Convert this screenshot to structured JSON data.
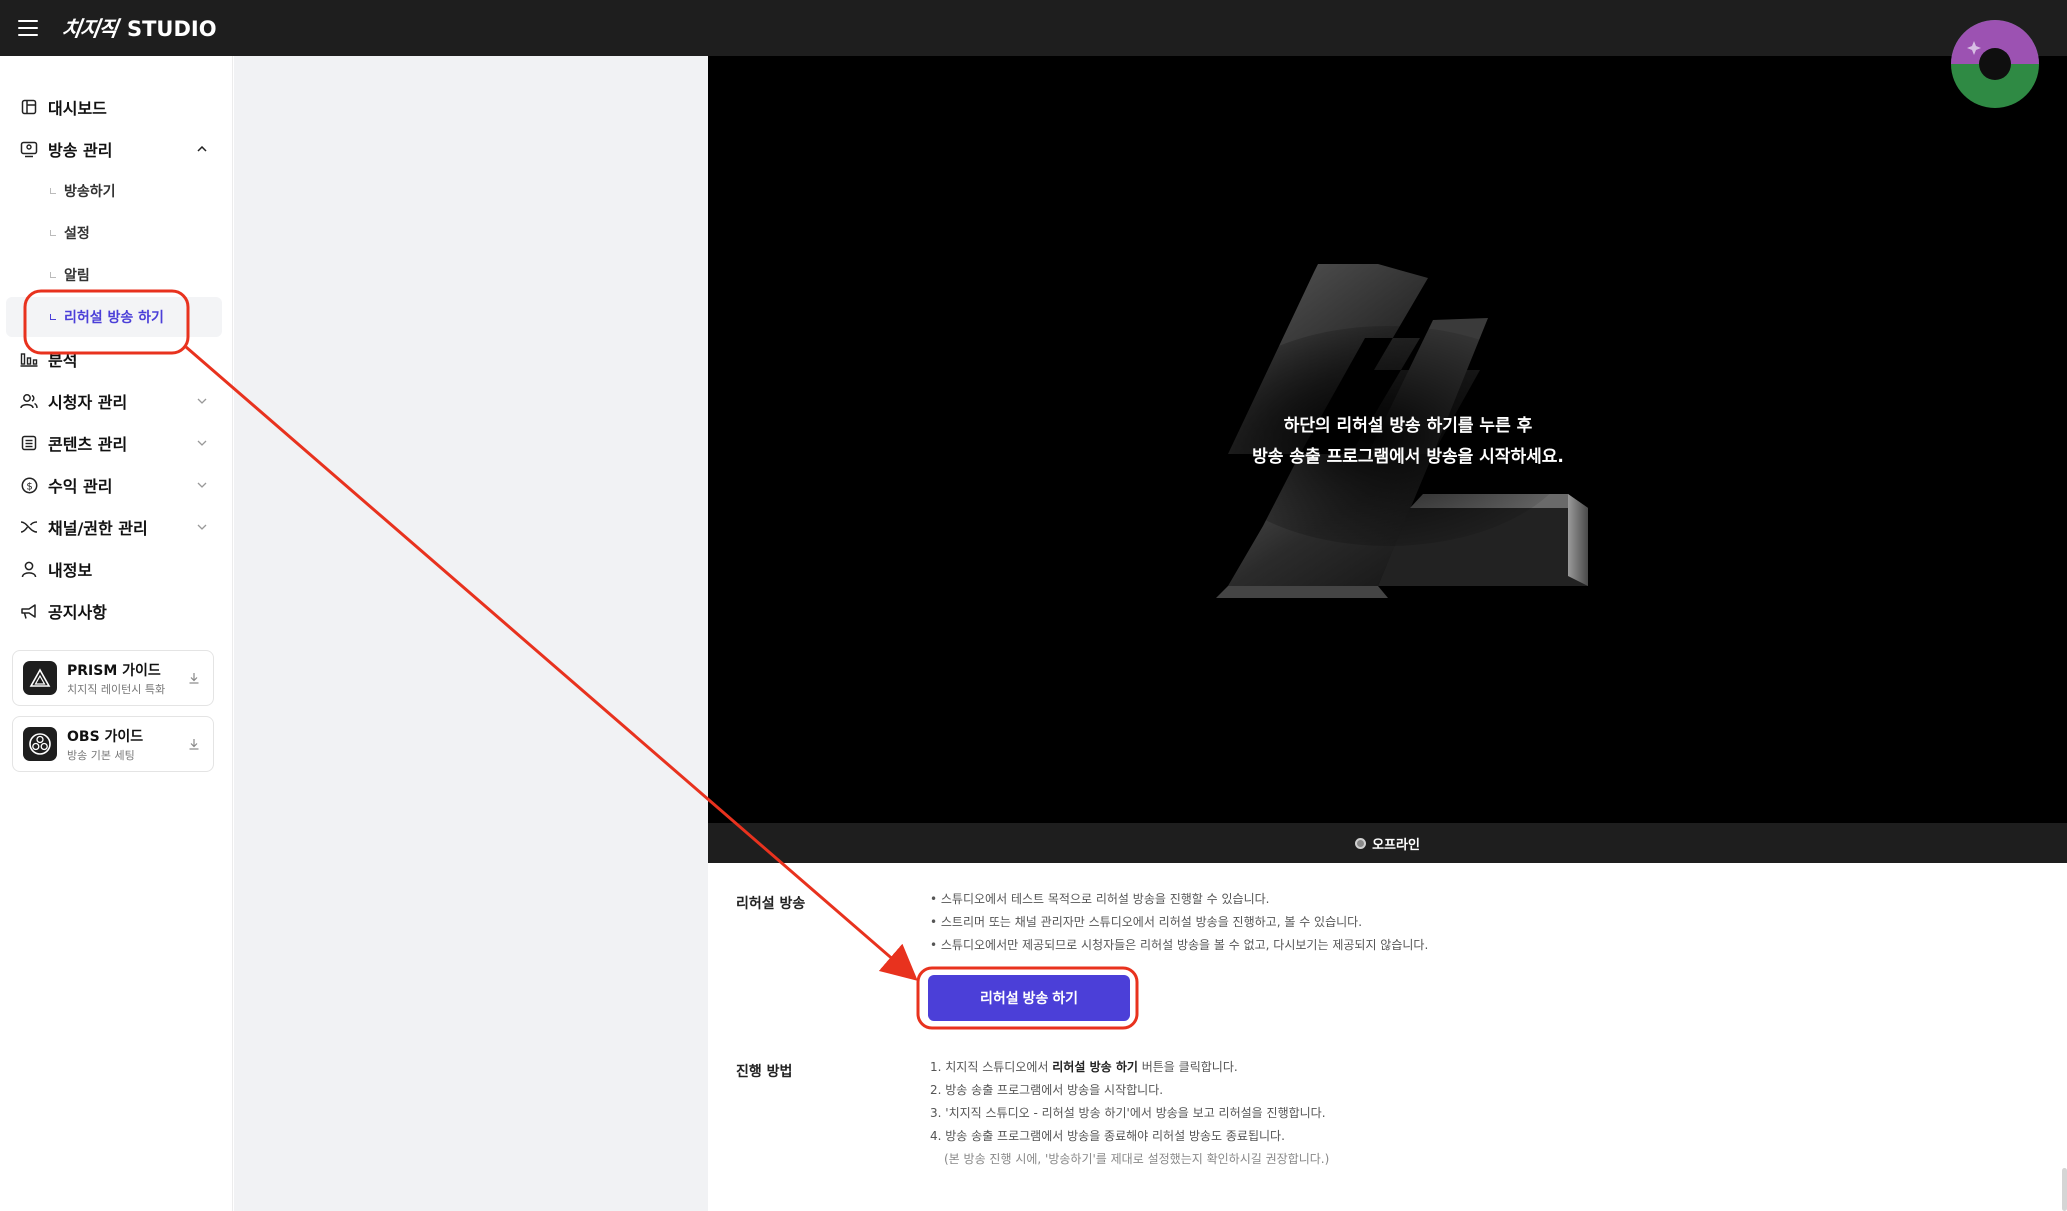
{
  "header": {
    "logo_text": "치지직",
    "studio_text": "STUDIO"
  },
  "sidebar": {
    "items": [
      {
        "label": "대시보드",
        "icon": "dashboard-icon"
      },
      {
        "label": "방송 관리",
        "icon": "broadcast-icon",
        "expanded": true
      },
      {
        "label": "분석",
        "icon": "analytics-icon"
      },
      {
        "label": "시청자 관리",
        "icon": "viewers-icon"
      },
      {
        "label": "콘텐츠 관리",
        "icon": "content-icon"
      },
      {
        "label": "수익 관리",
        "icon": "revenue-icon"
      },
      {
        "label": "채널/권한 관리",
        "icon": "channel-icon"
      },
      {
        "label": "내정보",
        "icon": "profile-icon"
      },
      {
        "label": "공지사항",
        "icon": "megaphone-icon"
      }
    ],
    "subitems": [
      {
        "label": "방송하기"
      },
      {
        "label": "설정"
      },
      {
        "label": "알림"
      },
      {
        "label": "리허설 방송 하기",
        "active": true
      }
    ],
    "guides": [
      {
        "title": "PRISM 가이드",
        "subtitle": "치지직 레이턴시 특화",
        "icon": "prism-icon"
      },
      {
        "title": "OBS 가이드",
        "subtitle": "방송 기본 세팅",
        "icon": "obs-icon"
      }
    ]
  },
  "video": {
    "overlay_line1": "하단의 리허설 방송 하기를 누른 후",
    "overlay_line2": "방송 송출 프로그램에서 방송을 시작하세요.",
    "status": "오프라인"
  },
  "rehearsal": {
    "title": "리허설 방송",
    "bullets": [
      "• 스튜디오에서 테스트 목적으로 리허설 방송을 진행할 수 있습니다.",
      "• 스트리머 또는 채널 관리자만 스튜디오에서 리허설 방송을 진행하고, 볼 수 있습니다.",
      "• 스튜디오에서만 제공되므로 시청자들은 리허설 방송을 볼 수 없고, 다시보기는 제공되지 않습니다."
    ],
    "button_label": "리허설 방송 하기"
  },
  "procedure": {
    "title": "진행 방법",
    "step1_prefix": "1. 치지직 스튜디오에서 ",
    "step1_bold": "리허설 방송 하기",
    "step1_suffix": " 버튼을 클릭합니다.",
    "step2": "2. 방송 송출 프로그램에서 방송을 시작합니다.",
    "step3": "3. '치지직 스튜디오 - 리허설 방송 하기'에서 방송을 보고 리허설을 진행합니다.",
    "step4": "4. 방송 송출 프로그램에서 방송을 종료해야 리허설 방송도 종료됩니다.",
    "note": "(본 방송 진행 시에, '방송하기'를 제대로 설정했는지 확인하시길 권장합니다.)"
  },
  "colors": {
    "accent": "#4b3fd8",
    "annotation": "#e8321e",
    "header_bg": "#1e1e1e"
  }
}
